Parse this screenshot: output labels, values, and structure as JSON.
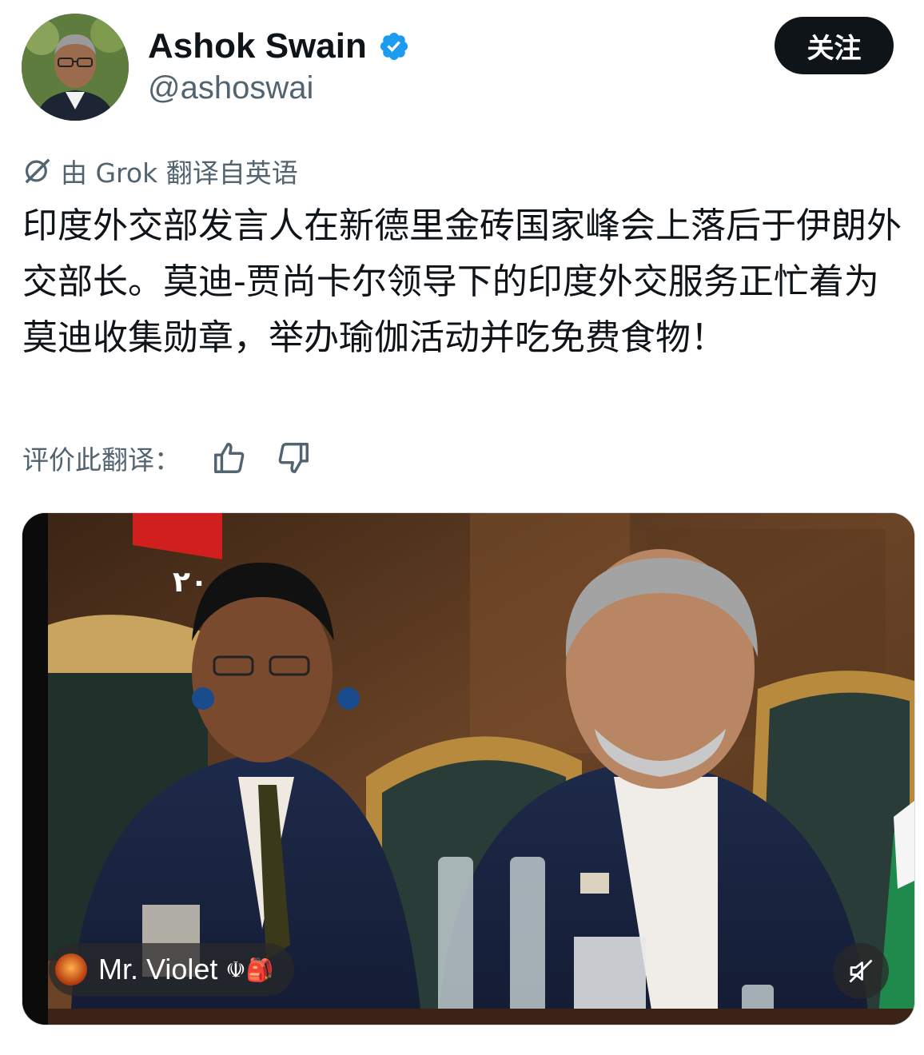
{
  "author": {
    "name": "Ashok Swain",
    "handle": "@ashoswai",
    "verified_color": "#1d9bf0"
  },
  "follow_button": {
    "label": "关注"
  },
  "translation": {
    "label": "由 Grok 翻译自英语"
  },
  "tweet": {
    "text": "印度外交部发言人在新德里金砖国家峰会上落后于伊朗外交部长。莫迪-贾尚卡尔领导下的印度外交服务正忙着为莫迪收集勋章，举办瑜伽活动并吃免费食物！"
  },
  "rating": {
    "label": "评价此翻译：",
    "up_icon": "thumbs-up-icon",
    "down_icon": "thumbs-down-icon"
  },
  "media": {
    "overlay_user": "Mr. Violet",
    "overlay_emoji": "☫🎒",
    "banner_numeral": "٢٠٠",
    "mute_icon": "speaker-muted-icon"
  }
}
